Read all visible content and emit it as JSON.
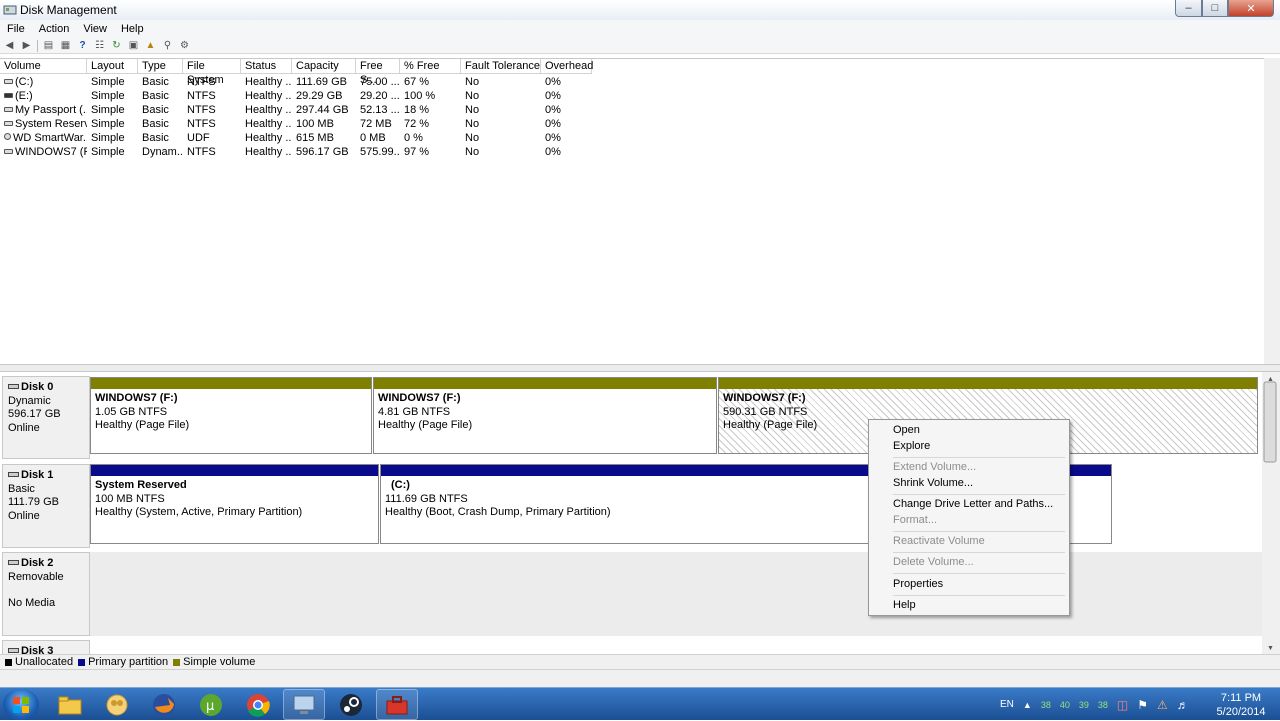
{
  "window": {
    "title": "Disk Management",
    "min": "–",
    "max": "□",
    "close": "✕"
  },
  "menu": [
    "File",
    "Action",
    "View",
    "Help"
  ],
  "volume_list": {
    "columns": [
      "Volume",
      "Layout",
      "Type",
      "File System",
      "Status",
      "Capacity",
      "Free S...",
      "% Free",
      "Fault Tolerance",
      "Overhead"
    ],
    "rows": [
      [
        "(C:)",
        "Simple",
        "Basic",
        "NTFS",
        "Healthy ...",
        "111.69 GB",
        "75.00 ...",
        "67 %",
        "No",
        "0%"
      ],
      [
        "(E:)",
        "Simple",
        "Basic",
        "NTFS",
        "Healthy ...",
        "29.29 GB",
        "29.20 ...",
        "100 %",
        "No",
        "0%"
      ],
      [
        "My Passport (...",
        "Simple",
        "Basic",
        "NTFS",
        "Healthy ...",
        "297.44 GB",
        "52.13 ...",
        "18 %",
        "No",
        "0%"
      ],
      [
        "System Reserv...",
        "Simple",
        "Basic",
        "NTFS",
        "Healthy ...",
        "100 MB",
        "72 MB",
        "72 %",
        "No",
        "0%"
      ],
      [
        "WD SmartWar...",
        "Simple",
        "Basic",
        "UDF",
        "Healthy ...",
        "615 MB",
        "0 MB",
        "0 %",
        "No",
        "0%"
      ],
      [
        "WINDOWS7 (F:)",
        "Simple",
        "Dynam...",
        "NTFS",
        "Healthy ...",
        "596.17 GB",
        "575.99...",
        "97 %",
        "No",
        "0%"
      ]
    ]
  },
  "disks": {
    "disk0": {
      "name": "Disk 0",
      "type": "Dynamic",
      "size": "596.17 GB",
      "status": "Online",
      "partitions": [
        {
          "name": "WINDOWS7  (F:)",
          "size": "1.05 GB NTFS",
          "health": "Healthy (Page File)"
        },
        {
          "name": "WINDOWS7  (F:)",
          "size": "4.81 GB NTFS",
          "health": "Healthy (Page File)"
        },
        {
          "name": "WINDOWS7  (F:)",
          "size": "590.31 GB NTFS",
          "health": "Healthy (Page File)"
        }
      ]
    },
    "disk1": {
      "name": "Disk 1",
      "type": "Basic",
      "size": "111.79 GB",
      "status": "Online",
      "partitions": [
        {
          "name": "System Reserved",
          "size": "100 MB NTFS",
          "health": "Healthy (System, Active, Primary Partition)"
        },
        {
          "name": "(C:)",
          "size": "111.69 GB NTFS",
          "health": "Healthy (Boot, Crash Dump, Primary Partition)"
        }
      ]
    },
    "disk2": {
      "name": "Disk 2",
      "type": "Removable",
      "status": "No Media"
    },
    "disk3": {
      "name": "Disk 3"
    }
  },
  "legend": [
    {
      "label": "Unallocated",
      "color": "#000000"
    },
    {
      "label": "Primary partition",
      "color": "#0a0a8c"
    },
    {
      "label": "Simple volume",
      "color": "#808000"
    }
  ],
  "context_menu": {
    "open": "Open",
    "explore": "Explore",
    "extend": "Extend Volume...",
    "shrink": "Shrink Volume...",
    "change_letter": "Change Drive Letter and Paths...",
    "format": "Format...",
    "reactivate": "Reactivate Volume",
    "delete": "Delete Volume...",
    "properties": "Properties",
    "help": "Help"
  },
  "tray": {
    "language": "EN",
    "temps": [
      "38",
      "40",
      "39",
      "38"
    ],
    "time": "7:11 PM",
    "date": "5/20/2014"
  },
  "colors": {
    "simple_volume": "#808000",
    "primary_partition": "#0a0a8c"
  }
}
